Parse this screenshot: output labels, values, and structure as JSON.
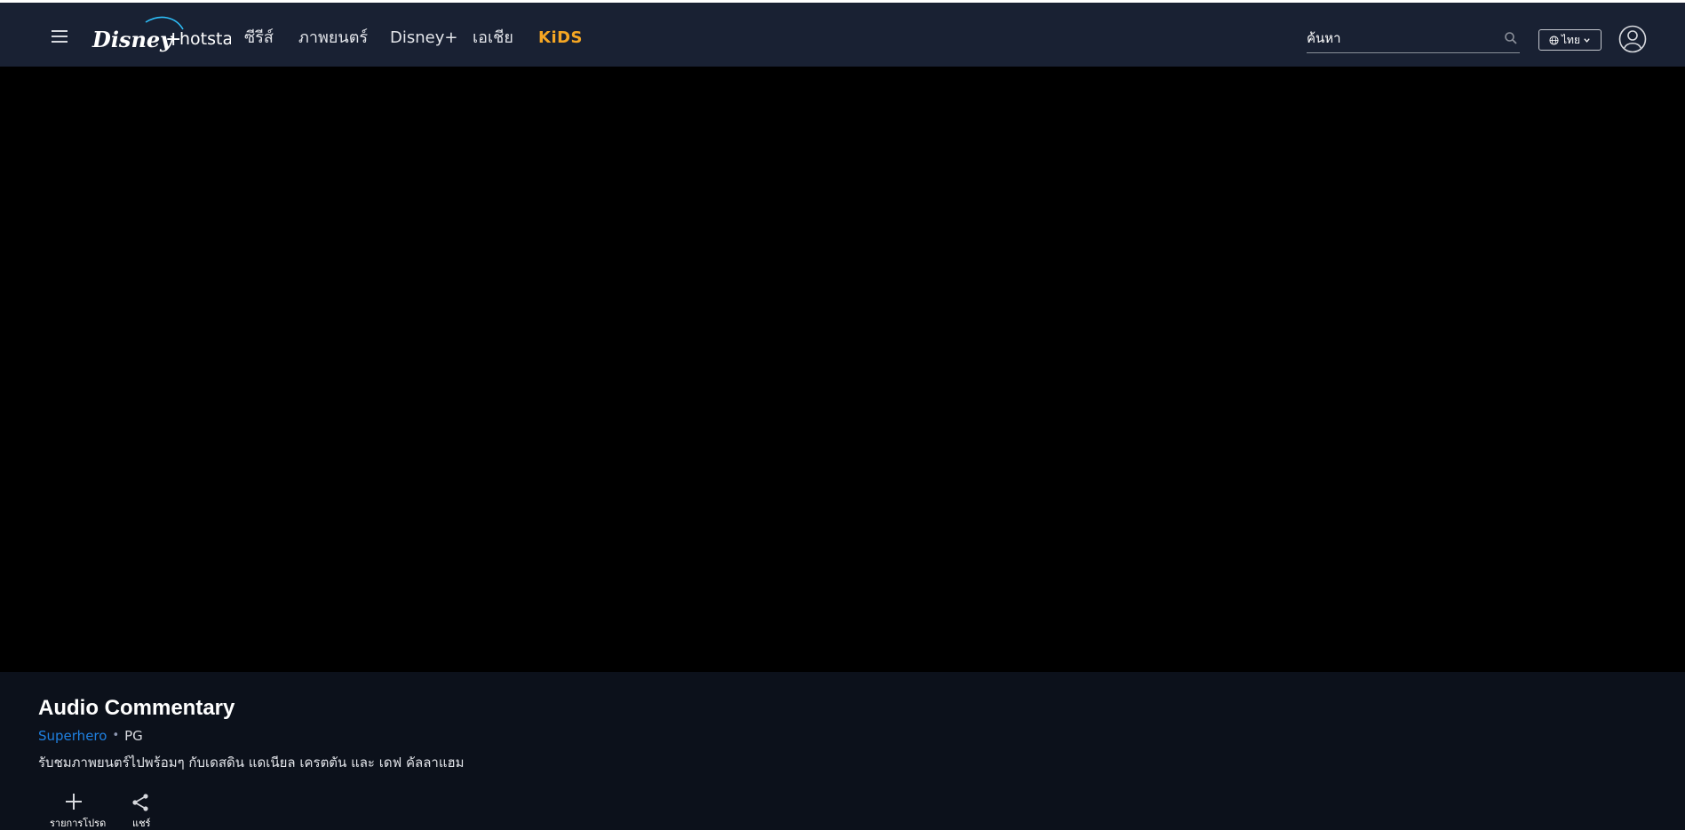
{
  "nav": {
    "brand": "Disney+ hotstar",
    "items": [
      {
        "label": "ซีรีส์"
      },
      {
        "label": "ภาพยนตร์"
      },
      {
        "label": "Disney+"
      },
      {
        "label": "เอเชีย"
      },
      {
        "label": "KiDS"
      }
    ]
  },
  "search": {
    "placeholder": "ค้นหา",
    "value": ""
  },
  "language": {
    "label": "ไทย"
  },
  "content": {
    "title": "Audio Commentary",
    "genre": "Superhero",
    "separator": "•",
    "rating": "PG",
    "description": "รับชมภาพยนตร์ไปพร้อมๆ กับเดสดิน แดเนียล เครตตัน และ เดฟ คัลลาแฮม"
  },
  "actions": {
    "watchlist_label": "รายการโปรด",
    "share_label": "แชร์"
  },
  "colors": {
    "nav_bg": "#192133",
    "page_bg": "#0c111b",
    "player_bg": "#000000",
    "genre_link": "#1f80e0",
    "kids": "#f5a623"
  }
}
